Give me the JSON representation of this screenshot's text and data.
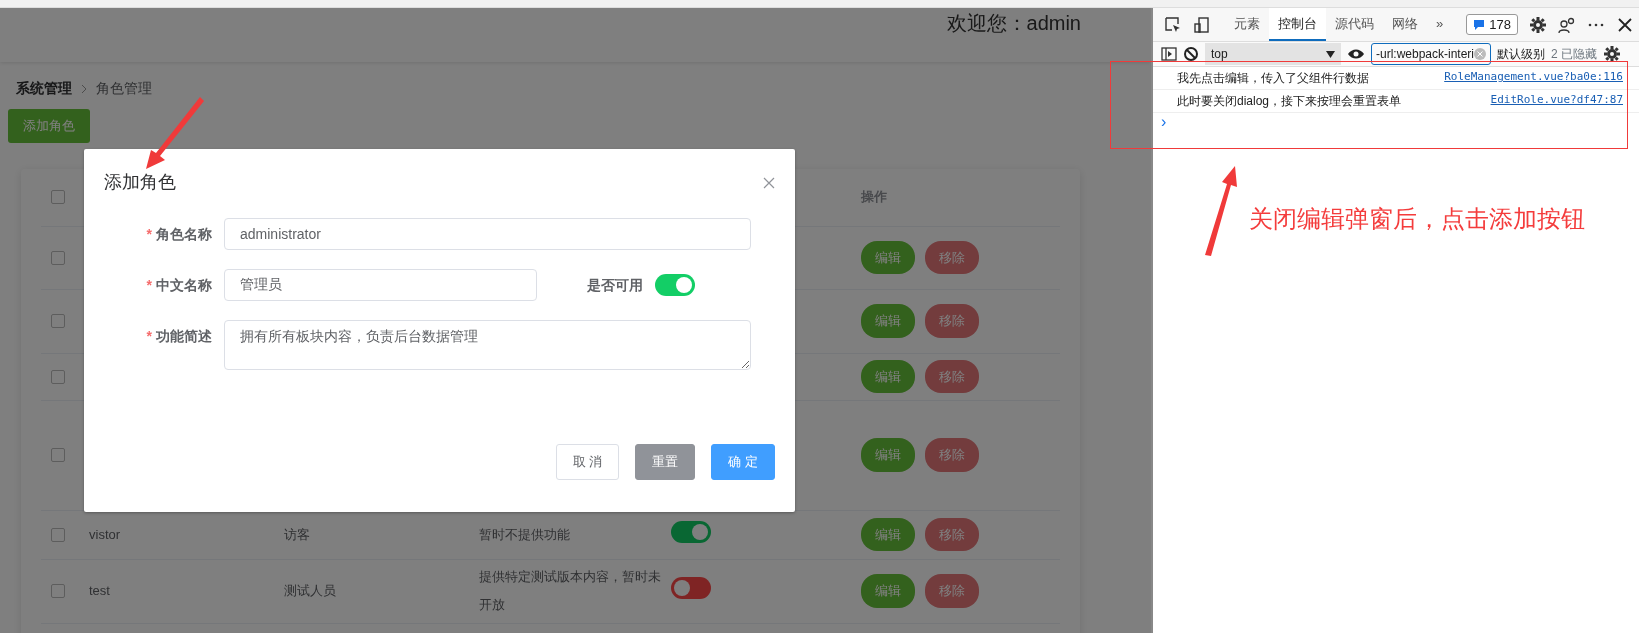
{
  "header": {
    "welcome": "欢迎您：admin"
  },
  "breadcrumb": [
    {
      "label": "系统管理"
    },
    {
      "label": "角色管理"
    }
  ],
  "add_button": "添加角色",
  "table": {
    "select_all": {
      "checked": false
    },
    "action_column": "操作",
    "rows": [
      {
        "checked": false,
        "edit": "编辑",
        "remove": "移除"
      },
      {
        "checked": false,
        "edit": "编辑",
        "remove": "移除"
      },
      {
        "checked": false,
        "edit": "编辑",
        "remove": "移除"
      },
      {
        "checked": false,
        "edit": "编辑",
        "remove": "移除"
      },
      {
        "checked": false,
        "name": "vistor",
        "cn_name": "访客",
        "description": "暂时不提供功能",
        "enabled": true,
        "edit": "编辑",
        "remove": "移除"
      },
      {
        "checked": false,
        "name": "test",
        "cn_name": "测试人员",
        "description": "提供特定测试版本内容，暂时未开放",
        "enabled": false,
        "edit": "编辑",
        "remove": "移除"
      }
    ]
  },
  "dialog": {
    "title": "添加角色",
    "fields": [
      {
        "asterisk": "*",
        "label": "角色名称",
        "value": "administrator"
      },
      {
        "asterisk": "*",
        "label": "中文名称",
        "value": "管理员"
      },
      {
        "asterisk": "*",
        "label": "功能简述",
        "value": "拥有所有板块内容，负责后台数据管理"
      }
    ],
    "switch": {
      "label": "是否可用",
      "on": true
    },
    "buttons": [
      {
        "label": "取 消",
        "kind": "plain"
      },
      {
        "label": "重置",
        "kind": "info"
      },
      {
        "label": "确 定",
        "kind": "primary"
      }
    ]
  },
  "devtools": {
    "tabs": [
      {
        "label": "元素",
        "selected": false
      },
      {
        "label": "控制台",
        "selected": true
      },
      {
        "label": "源代码",
        "selected": false
      },
      {
        "label": "网络",
        "selected": false
      }
    ],
    "more": "»",
    "issues_count": "178",
    "context": "top",
    "filter": "-url:webpack-interi",
    "levels": "默认级别",
    "hidden": "2 已隐藏",
    "messages": [
      {
        "text": "我先点击编辑，传入了父组件行数据",
        "source": "RoleManagement.vue?ba0e:116"
      },
      {
        "text": "此时要关闭dialog，接下来按理会重置表单",
        "source": "EditRole.vue?df47:87"
      }
    ],
    "prompt": "›"
  },
  "annotation": {
    "text": "关闭编辑弹窗后，点击添加按钮"
  }
}
